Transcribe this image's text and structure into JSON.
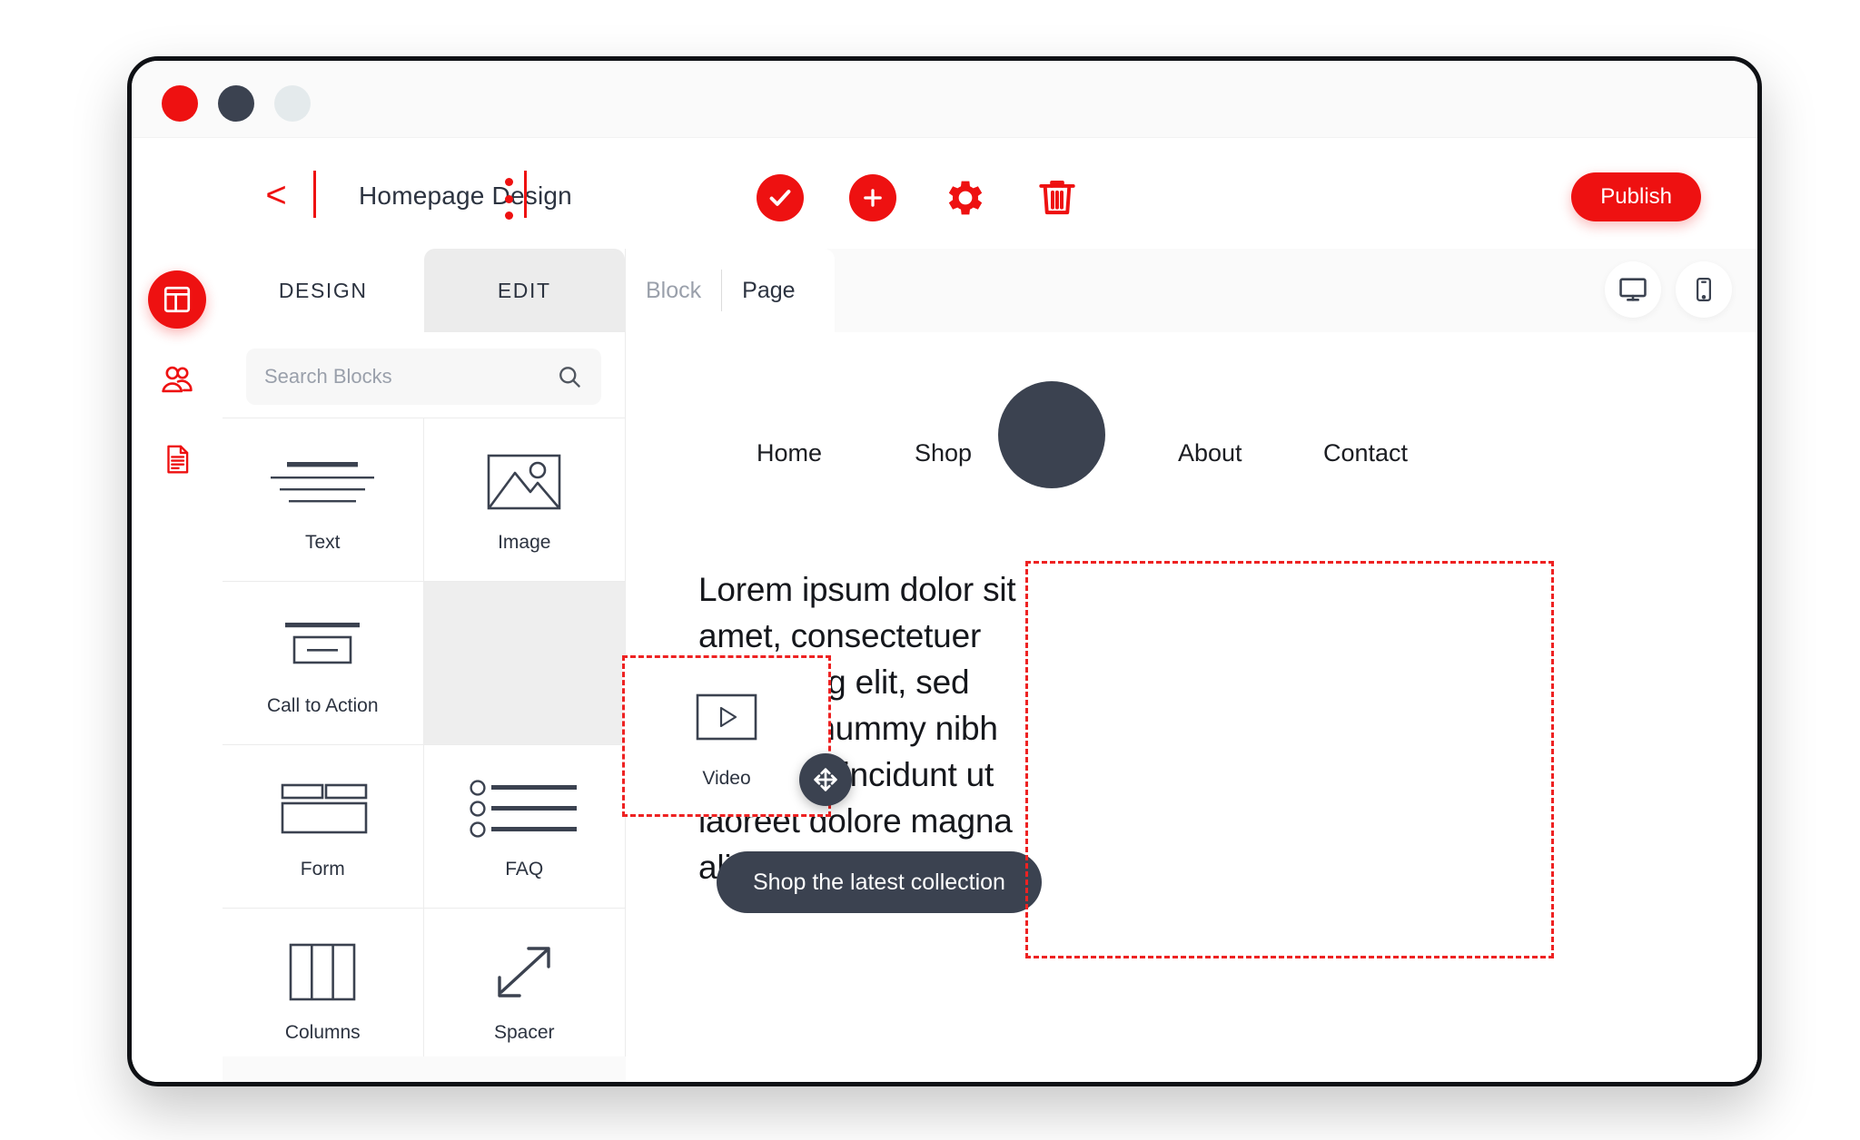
{
  "window": {
    "traffic_lights": [
      "close",
      "minimize",
      "maximize"
    ],
    "colors": {
      "accent": "#ee1111",
      "dark": "#3b4250",
      "panel_active": "#ececec"
    }
  },
  "toolbar": {
    "back_icon": "chevron-left-icon",
    "title": "Homepage Design",
    "kebab_icon": "more-vertical-icon",
    "actions": [
      {
        "name": "approve-button",
        "icon": "check-circle-icon"
      },
      {
        "name": "add-button",
        "icon": "plus-circle-icon"
      },
      {
        "name": "settings-button",
        "icon": "gear-icon"
      },
      {
        "name": "delete-button",
        "icon": "trash-icon"
      }
    ],
    "publish_label": "Publish"
  },
  "left_rail": {
    "items": [
      {
        "name": "layout",
        "icon": "layout-icon",
        "active": true
      },
      {
        "name": "people",
        "icon": "users-icon",
        "active": false
      },
      {
        "name": "pages",
        "icon": "document-icon",
        "active": false
      }
    ]
  },
  "blocks_panel": {
    "tabs": [
      {
        "label": "DESIGN",
        "active": false
      },
      {
        "label": "EDIT",
        "active": true
      }
    ],
    "search": {
      "placeholder": "Search Blocks",
      "value": "",
      "icon": "search-icon"
    },
    "blocks": [
      {
        "label": "Text",
        "icon": "text-lines-icon"
      },
      {
        "label": "Image",
        "icon": "image-icon"
      },
      {
        "label": "Call to Action",
        "icon": "cta-icon"
      },
      {
        "label": "Video",
        "icon": "video-icon"
      },
      {
        "label": "Form",
        "icon": "form-icon"
      },
      {
        "label": "FAQ",
        "icon": "faq-icon"
      },
      {
        "label": "Columns",
        "icon": "columns-icon"
      },
      {
        "label": "Spacer",
        "icon": "spacer-arrow-icon"
      }
    ],
    "dragging": {
      "label": "Video",
      "icon": "video-icon",
      "handle_icon": "move-icon",
      "border_color": "#ee2222"
    }
  },
  "canvas": {
    "tabs": [
      {
        "label": "Block",
        "active": false
      },
      {
        "label": "Page",
        "active": true
      }
    ],
    "device_toggle": [
      {
        "name": "desktop",
        "icon": "monitor-icon",
        "active": true
      },
      {
        "name": "mobile",
        "icon": "smartphone-icon",
        "active": false
      }
    ],
    "site": {
      "logo": "circle-logo",
      "nav": [
        "Home",
        "Shop",
        "About",
        "Contact"
      ],
      "hero_text": "Lorem ipsum dolor sit amet, consectetuer adipiscing elit, sed diam nonummy nibh euismod tincidunt ut laoreet dolore magna aliquam erat",
      "cta_label": "Shop the latest collection",
      "drop_zone": {
        "empty": true,
        "border_color": "#ee2222"
      }
    }
  }
}
